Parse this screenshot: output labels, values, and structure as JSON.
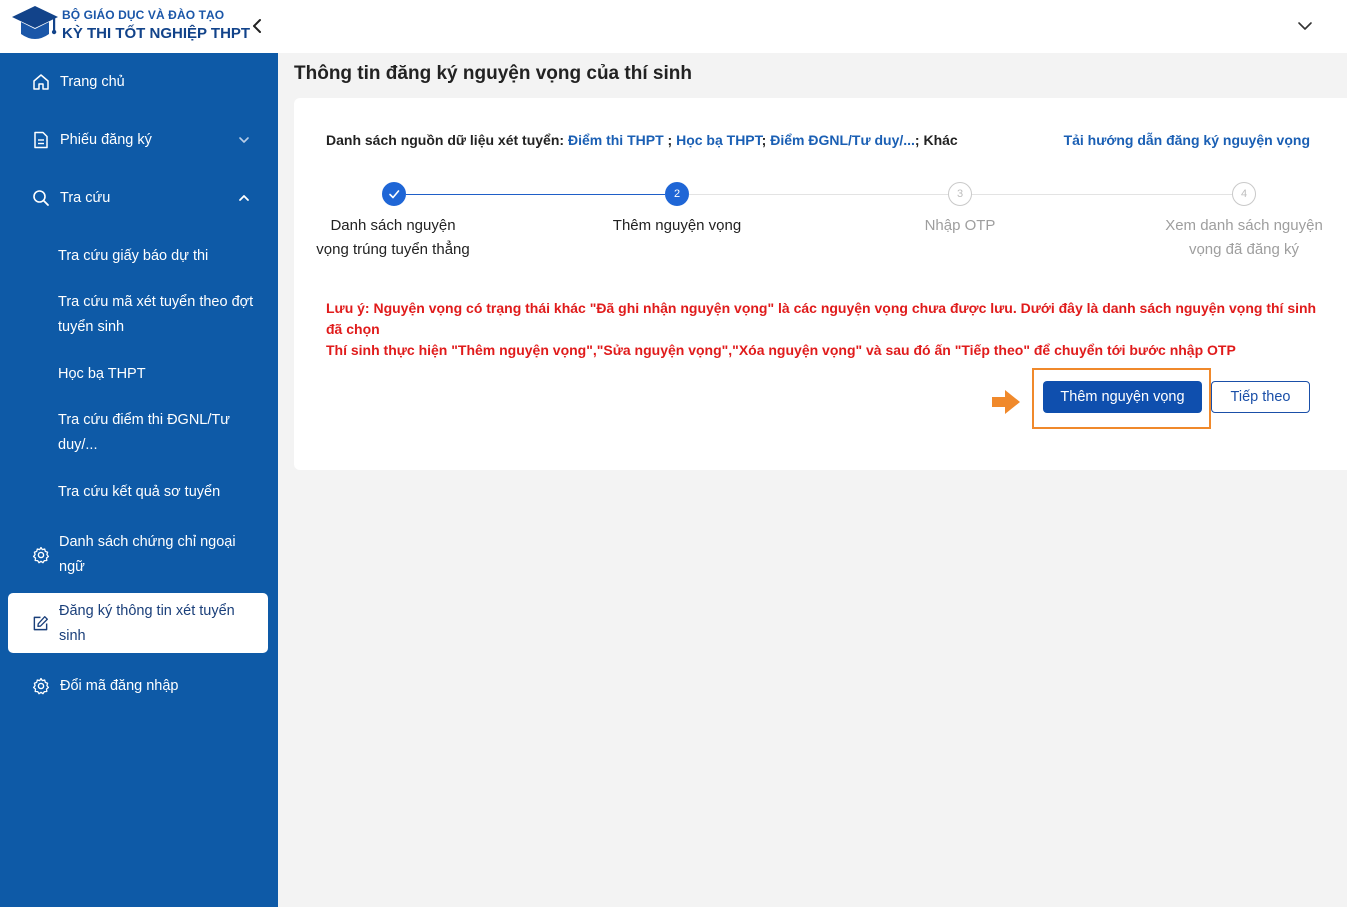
{
  "header": {
    "brand_top": "BỘ GIÁO DỤC VÀ ĐÀO TẠO",
    "brand_bottom": "KỲ THI TỐT NGHIỆP THPT",
    "colors": {
      "brand": "#12438a",
      "sidebar": "#0e5aa7"
    }
  },
  "sidebar": {
    "home": "Trang chủ",
    "registration_form": "Phiếu đăng ký",
    "lookup": "Tra cứu",
    "lookup_items": [
      "Tra cứu giấy báo dự thi",
      "Tra cứu mã xét tuyển theo đợt tuyển sinh",
      "Học bạ THPT",
      "Tra cứu điểm thi ĐGNL/Tư duy/...",
      "Tra cứu kết quả sơ tuyển"
    ],
    "certificates": "Danh sách chứng chỉ ngoại ngữ",
    "admission_registration": "Đăng ký thông tin xét tuyển sinh",
    "change_login": "Đổi mã đăng nhập"
  },
  "main": {
    "title": "Thông tin đăng ký nguyện vọng của thí sinh",
    "sources": {
      "label": "Danh sách nguồn dữ liệu xét tuyển:",
      "link1": "Điểm thi THPT",
      "sep1": " ; ",
      "link2": "Học bạ THPT",
      "sep2": "; ",
      "link3": "Điểm ĐGNL/Tư duy/...",
      "tail": "; Khác"
    },
    "guide_link": "Tải hướng dẫn đăng ký nguyện vọng",
    "steps": [
      {
        "number": "",
        "label": "Danh sách nguyện vọng trúng tuyển thẳng",
        "state": "done"
      },
      {
        "number": "2",
        "label": "Thêm nguyện vọng",
        "state": "current"
      },
      {
        "number": "3",
        "label": "Nhập OTP",
        "state": "todo"
      },
      {
        "number": "4",
        "label": "Xem danh sách nguyện vọng đã đăng ký",
        "state": "todo"
      }
    ],
    "notice_line1": "Lưu ý: Nguyện vọng có trạng thái khác \"Đã ghi nhận nguyện vọng\" là các nguyện vọng chưa được lưu. Dưới đây là danh sách nguyện vọng thí sinh đã chọn",
    "notice_line2": "Thí sinh thực hiện \"Thêm nguyện vọng\",\"Sửa nguyện vọng\",\"Xóa nguyện vọng\" và sau đó ấn \"Tiếp theo\" để chuyển tới bước nhập OTP",
    "add_button": "Thêm nguyện vọng",
    "next_button": "Tiếp theo"
  }
}
